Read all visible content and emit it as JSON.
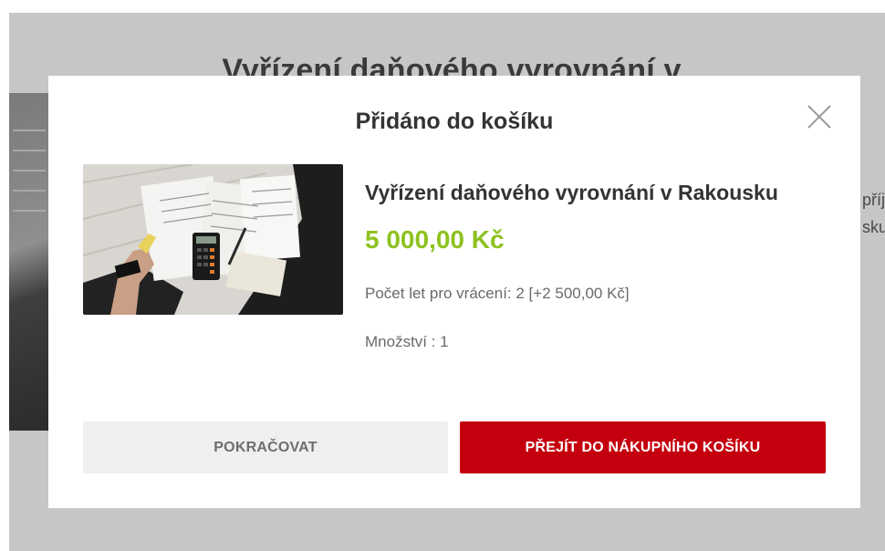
{
  "background": {
    "title": "Vyřízení daňového vyrovnání v",
    "side_text_line1": "příj",
    "side_text_line2": "sku"
  },
  "modal": {
    "title": "Přidáno do košíku",
    "close_icon": "close-icon",
    "product": {
      "image_icon": "product-photo",
      "name": "Vyřízení daňového vyrovnání v Rakousku",
      "price": "5 000,00 Kč",
      "option": "Počet let pro vrácení: 2 [+2 500,00 Kč]",
      "quantity": "Množství : 1"
    },
    "buttons": {
      "continue_label": "POKRAČOVAT",
      "cart_label": "PŘEJÍT DO NÁKUPNÍHO KOŠÍKU"
    }
  },
  "colors": {
    "overlay": "#c6c6c6",
    "price": "#8dc21f",
    "primary_button": "#c4000f",
    "secondary_button": "#efefef"
  }
}
